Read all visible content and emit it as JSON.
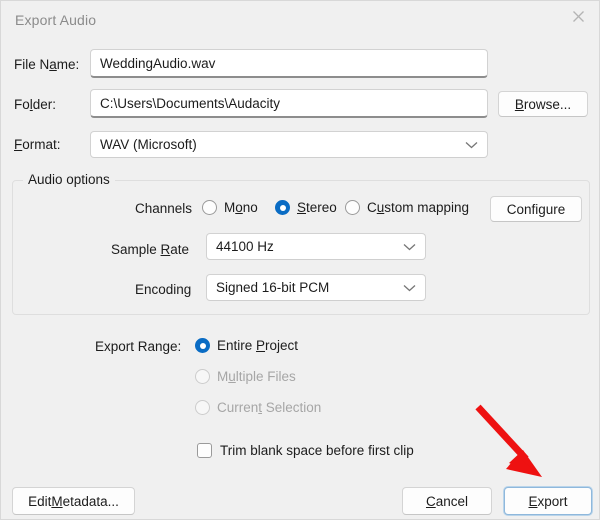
{
  "window": {
    "title": "Export Audio",
    "close_icon": "close-icon"
  },
  "fields": {
    "file_name": {
      "label_pre": "File N",
      "label_mnemonic": "a",
      "label_post": "me:",
      "value": "WeddingAudio.wav"
    },
    "folder": {
      "label_pre": "Fo",
      "label_mnemonic": "l",
      "label_post": "der:",
      "value": "C:\\Users\\Documents\\Audacity",
      "browse_button": {
        "pre": "",
        "mnemonic": "B",
        "post": "rowse..."
      }
    },
    "format": {
      "label_pre": "",
      "label_mnemonic": "F",
      "label_post": "ormat:",
      "value": "WAV (Microsoft)",
      "chevron_icon": "chevron-down-icon"
    }
  },
  "audio_options": {
    "legend": "Audio options",
    "channels": {
      "label": "Channels",
      "options": [
        {
          "pre": "M",
          "mnemonic": "o",
          "post": "no",
          "checked": false,
          "disabled": false
        },
        {
          "pre": "",
          "mnemonic": "S",
          "post": "tereo",
          "checked": true,
          "disabled": false
        },
        {
          "pre": "C",
          "mnemonic": "u",
          "post": "stom mapping",
          "checked": false,
          "disabled": false
        }
      ],
      "configure_button": "Configure"
    },
    "sample_rate": {
      "label_pre": "Sample ",
      "label_mnemonic": "R",
      "label_post": "ate",
      "value": "44100 Hz",
      "chevron_icon": "chevron-down-icon"
    },
    "encoding": {
      "label": "Encoding",
      "value": "Signed 16-bit PCM",
      "chevron_icon": "chevron-down-icon"
    }
  },
  "export_range": {
    "label": "Export Range:",
    "options": [
      {
        "pre": "Entire ",
        "mnemonic": "P",
        "post": "roject",
        "checked": true,
        "disabled": false
      },
      {
        "pre": "M",
        "mnemonic": "u",
        "post": "ltiple Files",
        "checked": false,
        "disabled": true
      },
      {
        "pre": "Curren",
        "mnemonic": "t",
        "post": " Selection",
        "checked": false,
        "disabled": true
      }
    ]
  },
  "trim_checkbox": {
    "label": "Trim blank space before first clip",
    "checked": false
  },
  "footer": {
    "edit_metadata": {
      "pre": "Edit ",
      "mnemonic": "M",
      "post": "etadata..."
    },
    "cancel": {
      "pre": "",
      "mnemonic": "C",
      "post": "ancel"
    },
    "export": {
      "pre": "",
      "mnemonic": "E",
      "post": "xport"
    }
  },
  "annotation": {
    "arrow_color": "#ee1111",
    "arrow_icon": "red-arrow-pointer"
  }
}
